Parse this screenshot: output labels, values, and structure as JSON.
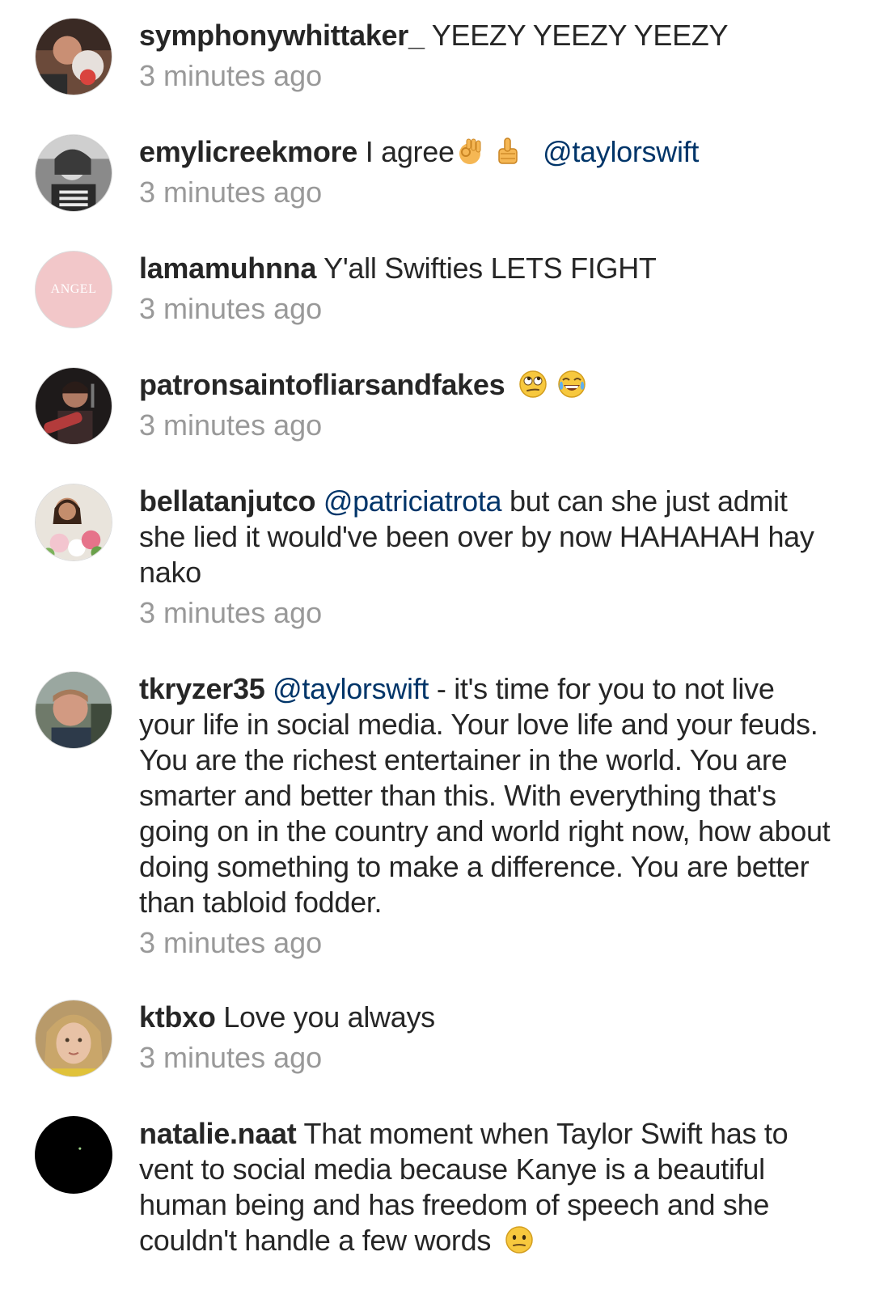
{
  "comments": [
    {
      "username": "symphonywhittaker_",
      "text": "YEEZY YEEZY YEEZY",
      "time": "3 minutes ago",
      "avatar": "photo-avatar"
    },
    {
      "username": "emylicreekmore",
      "text": "I agree",
      "mention": "@taylorswift",
      "time": "3 minutes ago",
      "avatar": "photo-avatar"
    },
    {
      "username": "lamamuhnna",
      "text": "Y'all Swifties LETS FIGHT",
      "time": "3 minutes ago",
      "avatar_label": "ANGEL"
    },
    {
      "username": "patronsaintofliarsandfakes",
      "time": "3 minutes ago",
      "avatar": "photo-avatar"
    },
    {
      "username": "bellatanjutco",
      "mention": "@patriciatrota",
      "text": "but can she just admit she lied it would've been over by now HAHAHAH hay nako",
      "time": "3 minutes ago",
      "avatar": "photo-avatar"
    },
    {
      "username": "tkryzer35",
      "mention": "@taylorswift",
      "text": "- it's time for you to not live your life in social media.  Your love life and your feuds.  You are the richest entertainer in the world. You are smarter and better than this.  With everything that's going on in the country and world right now, how about doing something to make a difference.  You are better than tabloid fodder.",
      "time": "3 minutes ago",
      "avatar": "photo-avatar"
    },
    {
      "username": "ktbxo",
      "text": "Love you always",
      "time": "3 minutes ago",
      "avatar": "photo-avatar"
    },
    {
      "username": "natalie.naat",
      "text": "That moment when Taylor Swift has to vent to social media because Kanye is a beautiful human being and has freedom of speech and she couldn't handle a few words",
      "avatar": "photo-avatar"
    }
  ],
  "colors": {
    "username": "#262626",
    "mention": "#003569",
    "timestamp": "#999999",
    "angel_avatar_bg": "#f2c7c9"
  }
}
